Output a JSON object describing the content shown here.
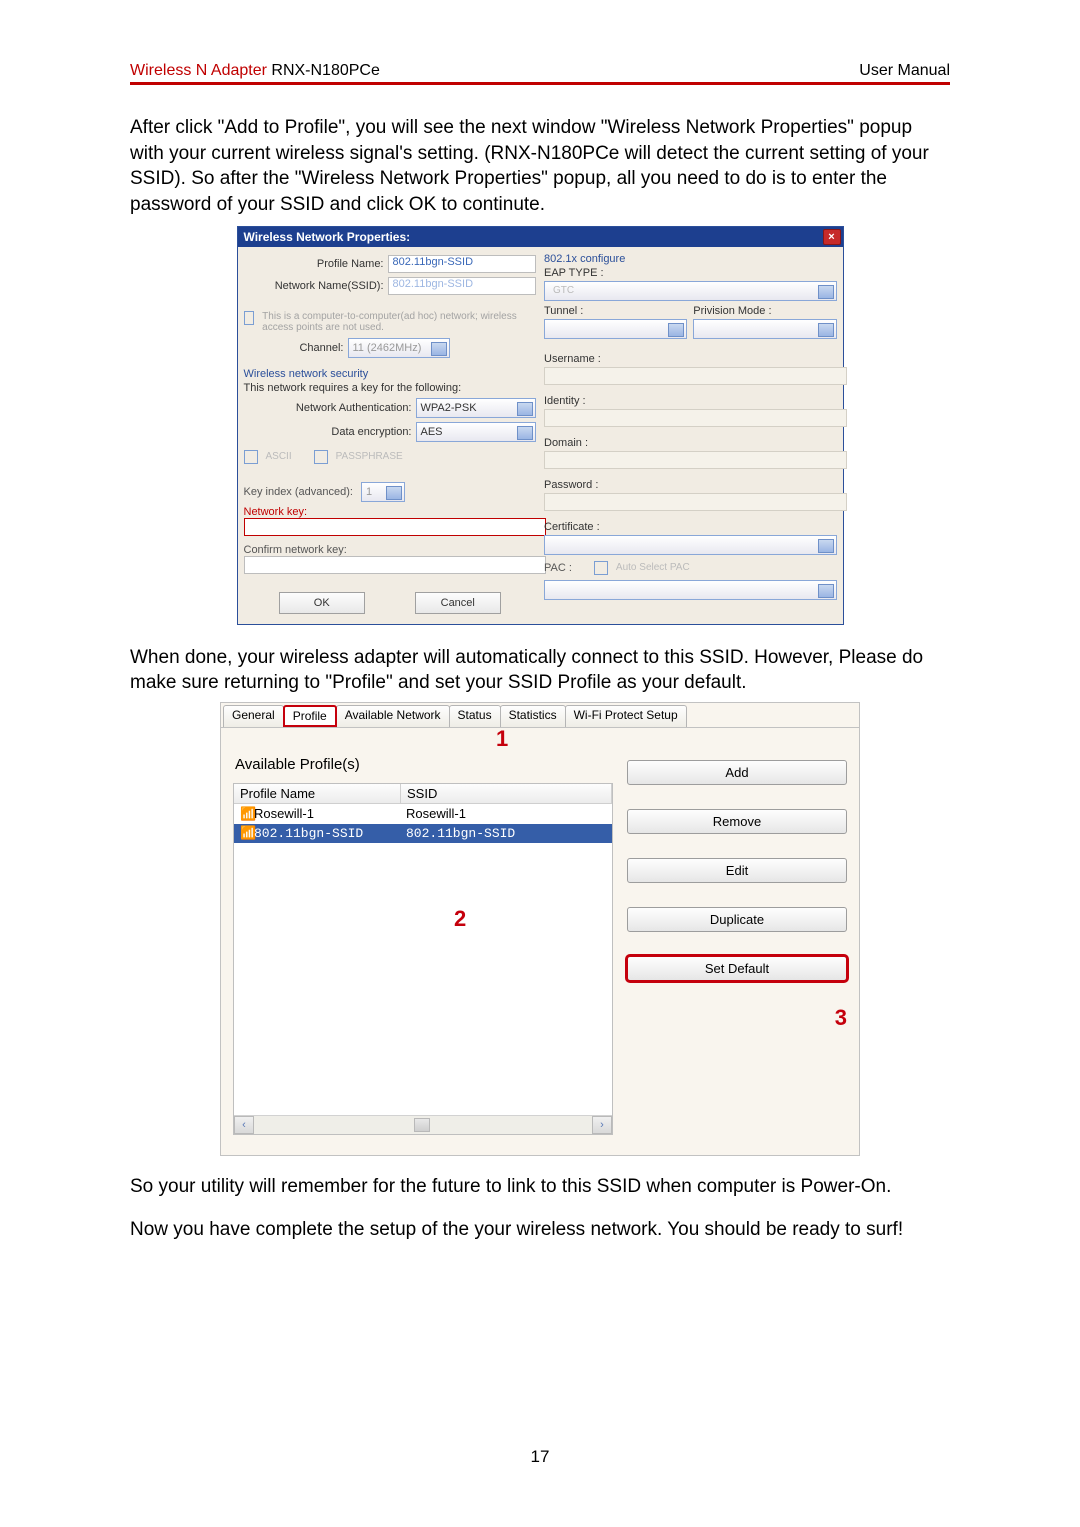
{
  "header": {
    "product_prefix": "Wireless N Adapter ",
    "product_model": "RNX-N180PCe",
    "right": "User Manual"
  },
  "para1": "After click \"Add to Profile\", you will see the next window \"Wireless Network Properties\" popup with your current wireless signal's setting. (RNX-N180PCe will detect the current setting of your SSID). So after the \"Wireless Network Properties\" popup, all you need to do is to enter the password of your SSID and click OK to continute.",
  "para2": "When done, your wireless adapter will automatically connect to this SSID. However, Please do make sure returning to \"Profile\" and set your SSID Profile as your default.",
  "para3": "So your utility will remember for the future to link to this SSID when computer is Power-On.",
  "para4": "Now you have complete the setup of the your wireless network. You should be ready to surf!",
  "page_number": "17",
  "dlg1": {
    "title": "Wireless Network Properties:",
    "profile_name_lbl": "Profile Name:",
    "profile_name_val": "802.11bgn-SSID",
    "network_name_lbl": "Network Name(SSID):",
    "network_name_val": "802.11bgn-SSID",
    "adhoc_text": "This is a computer-to-computer(ad hoc) network; wireless access points are not used.",
    "channel_lbl": "Channel:",
    "channel_val": "11 (2462MHz)",
    "sec_section": "Wireless network security",
    "sec_sub": "This network requires a key for the following:",
    "auth_lbl": "Network Authentication:",
    "auth_val": "WPA2-PSK",
    "enc_lbl": "Data encryption:",
    "enc_val": "AES",
    "ascii": "ASCII",
    "passphrase": "PASSPHRASE",
    "keyidx_lbl": "Key index (advanced):",
    "keyidx_val": "1",
    "netkey_lbl": "Network key:",
    "confkey_lbl": "Confirm network key:",
    "ok": "OK",
    "cancel": "Cancel",
    "r_section": "802.1x configure",
    "r_eaptype": "EAP TYPE :",
    "r_eaptype_val": "GTC",
    "r_tunnel": "Tunnel :",
    "r_prov": "Privision Mode :",
    "r_username": "Username :",
    "r_identity": "Identity :",
    "r_domain": "Domain :",
    "r_password": "Password :",
    "r_cert": "Certificate :",
    "r_pac": "PAC :",
    "r_autopac": "Auto Select PAC"
  },
  "dlg2": {
    "tabs": [
      "General",
      "Profile",
      "Available Network",
      "Status",
      "Statistics",
      "Wi-Fi Protect Setup"
    ],
    "selected_tab_index": 1,
    "available_lbl": "Available Profile(s)",
    "col1": "Profile Name",
    "col2": "SSID",
    "rows": [
      {
        "name": "Rosewill-1",
        "ssid": "Rosewill-1",
        "selected": false
      },
      {
        "name": "802.11bgn-SSID",
        "ssid": "802.11bgn-SSID",
        "selected": true
      }
    ],
    "buttons": [
      "Add",
      "Remove",
      "Edit",
      "Duplicate",
      "Set Default"
    ],
    "highlight_button_index": 4,
    "annotations": {
      "a1": "1",
      "a2": "2",
      "a3": "3"
    }
  }
}
